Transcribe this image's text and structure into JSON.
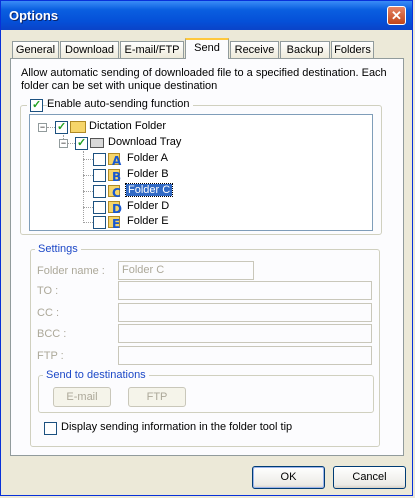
{
  "window": {
    "title": "Options",
    "close_glyph": "✕"
  },
  "tabs": [
    {
      "label": "General"
    },
    {
      "label": "Download"
    },
    {
      "label": "E-mail/FTP"
    },
    {
      "label": "Send"
    },
    {
      "label": "Receive"
    },
    {
      "label": "Backup"
    },
    {
      "label": "Folders"
    }
  ],
  "active_tab": "Send",
  "description": "Allow automatic sending of downloaded file to a specified destination. Each folder can be set with unique destination",
  "enable_checkbox": {
    "label": "Enable auto-sending function",
    "checked": true
  },
  "tree": {
    "root": {
      "label": "Dictation Folder",
      "checked": true,
      "expander": "−"
    },
    "child": {
      "label": "Download Tray",
      "checked": true,
      "expander": "−"
    },
    "folders": [
      {
        "letter": "A",
        "label": "Folder A",
        "checked": false,
        "selected": false
      },
      {
        "letter": "B",
        "label": "Folder B",
        "checked": false,
        "selected": false
      },
      {
        "letter": "C",
        "label": "Folder C",
        "checked": false,
        "selected": true
      },
      {
        "letter": "D",
        "label": "Folder D",
        "checked": false,
        "selected": false
      },
      {
        "letter": "E",
        "label": "Folder E",
        "checked": false,
        "selected": false
      }
    ]
  },
  "settings": {
    "title": "Settings",
    "folder_name_label": "Folder name :",
    "folder_name_value": "Folder C",
    "to_label": "TO :",
    "cc_label": "CC :",
    "bcc_label": "BCC :",
    "ftp_label": "FTP :",
    "send_to": {
      "title": "Send to destinations",
      "email_button": "E-mail",
      "ftp_button": "FTP"
    },
    "tooltip_checkbox": {
      "label": "Display sending information in the folder tool tip",
      "checked": false
    }
  },
  "buttons": {
    "ok": "OK",
    "cancel": "Cancel"
  },
  "colors": {
    "title_bar": "#0550d8",
    "group_title": "#1c48c7",
    "selection": "#316ac5",
    "tab_highlight": "#ffc83c"
  }
}
